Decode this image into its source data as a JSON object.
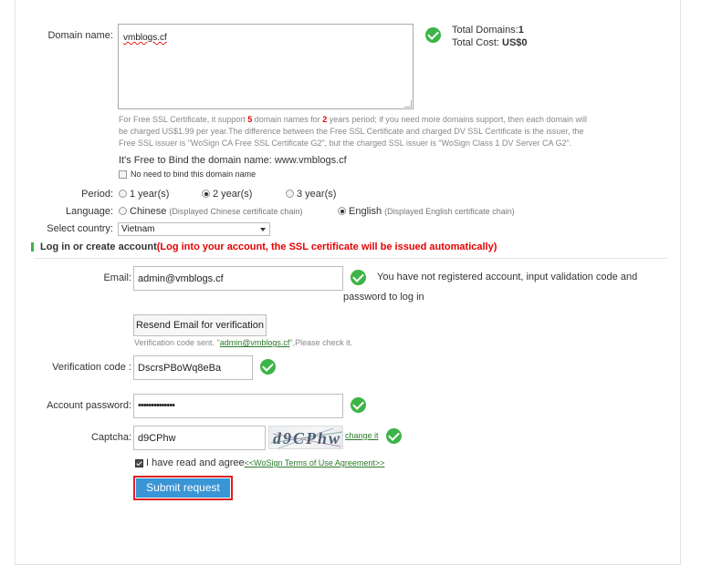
{
  "domain": {
    "label": "Domain name:",
    "value": "vmblogs.cf",
    "total_domains_label": "Total Domains:",
    "total_domains_value": "1",
    "total_cost_label": "Total Cost:",
    "total_cost_value": "US$0",
    "info_part1": "For Free SSL Certificate, it support ",
    "info_num1": "5",
    "info_part2": " domain names for ",
    "info_num2": "2",
    "info_part3": " years period; if you need more domains support, then each domain will",
    "info_line2": "be charged US$1.99 per year.The difference between the Free SSL Certificate and charged DV SSL Certificate is the issuer, the",
    "info_line3": "Free SSL issuer is \"WoSign CA Free SSL Certificate G2\", but the charged SSL issuer is \"WoSign Class 1 DV Server CA G2\".",
    "bind_text": "It's Free to Bind the domain name: www.vmblogs.cf",
    "no_bind_label": "No need to bind this domain name"
  },
  "period": {
    "label": "Period:",
    "options": [
      "1 year(s)",
      "2 year(s)",
      "3 year(s)"
    ],
    "selected": "2 year(s)"
  },
  "language": {
    "label": "Language:",
    "chinese": "Chinese",
    "chinese_note": "(Displayed Chinese certificate chain)",
    "english": "English",
    "english_note": "(Displayed English certificate chain)",
    "selected": "English"
  },
  "country": {
    "label": "Select country:",
    "value": "Vietnam"
  },
  "login": {
    "heading": "Log in or create account",
    "heading_note": "(Log into your account, the SSL certificate will be issued automatically)",
    "accent_color": "#3cb447",
    "warning_color": "#e60000"
  },
  "email": {
    "label": "Email:",
    "value": "admin@vmblogs.cf",
    "msg_line1": "You have not registered account, input validation code and",
    "msg_line2": "password to log in"
  },
  "resend": {
    "button": "Resend Email for verification",
    "note_before": "Verification code sent. \"",
    "note_link": "admin@vmblogs.cf",
    "note_after": "\",Please check it."
  },
  "verification": {
    "label": "Verification code :",
    "value": "DscrsPBoWq8eBa"
  },
  "password": {
    "label": "Account password:",
    "value": "••••••••••••••"
  },
  "captcha": {
    "label": "Captcha:",
    "value": "d9CPhw",
    "image_text": "d9CPhw",
    "change_link": "change it"
  },
  "agree": {
    "text": "I have read and agree",
    "link": "<<WoSign Terms of Use Agreement>>"
  },
  "submit": {
    "label": "Submit request",
    "color": "#3a95d6"
  }
}
